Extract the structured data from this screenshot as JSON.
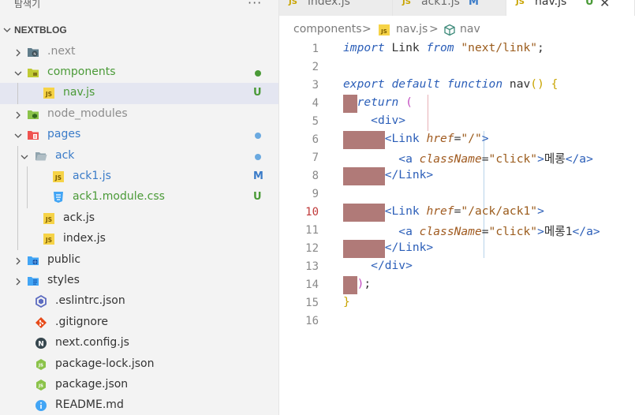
{
  "sidebar": {
    "title": "탐색기",
    "more": "···",
    "project": "NEXTBLOG",
    "items": [
      {
        "name": ".next",
        "style": "dim",
        "icon": "next-folder-icon",
        "twisty": "right",
        "depth": 1,
        "status": "",
        "statusColor": ""
      },
      {
        "name": "components",
        "style": "green",
        "icon": "components-folder-icon",
        "twisty": "down",
        "depth": 1,
        "status": "dot",
        "statusColor": "#4a9a37"
      },
      {
        "name": "nav.js",
        "style": "green",
        "icon": "js-file-icon",
        "twisty": "",
        "depth": 2,
        "status": "U",
        "statusColor": "#4a9a37",
        "selected": true
      },
      {
        "name": "node_modules",
        "style": "dim",
        "icon": "node-modules-folder-icon",
        "twisty": "right",
        "depth": 1,
        "status": "",
        "statusColor": ""
      },
      {
        "name": "pages",
        "style": "blue",
        "icon": "pages-folder-icon",
        "twisty": "down",
        "depth": 1,
        "status": "dot",
        "statusColor": "#6aa9e0"
      },
      {
        "name": "ack",
        "style": "blue",
        "icon": "folder-open-icon",
        "twisty": "down",
        "depth": 2,
        "status": "dot",
        "statusColor": "#6aa9e0"
      },
      {
        "name": "ack1.js",
        "style": "blue",
        "icon": "js-file-icon",
        "twisty": "",
        "depth": 3,
        "status": "M",
        "statusColor": "#3a7bc8"
      },
      {
        "name": "ack1.module.css",
        "style": "green",
        "icon": "css-file-icon",
        "twisty": "",
        "depth": 3,
        "status": "U",
        "statusColor": "#4a9a37"
      },
      {
        "name": "ack.js",
        "style": "",
        "icon": "js-file-icon",
        "twisty": "",
        "depth": 2,
        "status": "",
        "statusColor": ""
      },
      {
        "name": "index.js",
        "style": "",
        "icon": "js-file-icon",
        "twisty": "",
        "depth": 2,
        "status": "",
        "statusColor": ""
      },
      {
        "name": "public",
        "style": "",
        "icon": "public-folder-icon",
        "twisty": "right",
        "depth": 1,
        "status": "",
        "statusColor": ""
      },
      {
        "name": "styles",
        "style": "",
        "icon": "styles-folder-icon",
        "twisty": "right",
        "depth": 1,
        "status": "",
        "statusColor": ""
      },
      {
        "name": ".eslintrc.json",
        "style": "",
        "icon": "eslint-file-icon",
        "twisty": "",
        "depth": 1,
        "status": "",
        "statusColor": ""
      },
      {
        "name": ".gitignore",
        "style": "",
        "icon": "git-file-icon",
        "twisty": "",
        "depth": 1,
        "status": "",
        "statusColor": ""
      },
      {
        "name": "next.config.js",
        "style": "",
        "icon": "next-file-icon",
        "twisty": "",
        "depth": 1,
        "status": "",
        "statusColor": ""
      },
      {
        "name": "package-lock.json",
        "style": "",
        "icon": "node-file-icon",
        "twisty": "",
        "depth": 1,
        "status": "",
        "statusColor": ""
      },
      {
        "name": "package.json",
        "style": "",
        "icon": "node-file-icon",
        "twisty": "",
        "depth": 1,
        "status": "",
        "statusColor": ""
      },
      {
        "name": "README.md",
        "style": "",
        "icon": "info-file-icon",
        "twisty": "",
        "depth": 1,
        "status": "",
        "statusColor": ""
      }
    ]
  },
  "tabs": [
    {
      "label": "index.js",
      "status": "",
      "active": false
    },
    {
      "label": "ack1.js",
      "status": "M",
      "statusColor": "#3a7bc8",
      "active": false
    },
    {
      "label": "nav.js",
      "status": "U",
      "statusColor": "#4a9a37",
      "active": true
    }
  ],
  "tab_icon_text": "JS",
  "breadcrumb": {
    "folder": "components",
    "sep": ">",
    "file": "nav.js",
    "symbol": "nav"
  },
  "editor": {
    "current_line": 10,
    "lines": [
      [
        [
          "kw",
          "import"
        ],
        [
          "id",
          " Link "
        ],
        [
          "kw",
          "from"
        ],
        [
          "id",
          " "
        ],
        [
          "str",
          "\"next/link\""
        ],
        [
          "pn",
          ";"
        ]
      ],
      [],
      [
        [
          "kw",
          "export"
        ],
        [
          "id",
          " "
        ],
        [
          "kw",
          "default"
        ],
        [
          "id",
          " "
        ],
        [
          "kw",
          "function"
        ],
        [
          "id",
          " nav"
        ],
        [
          "br1",
          "()"
        ],
        [
          "id",
          " "
        ],
        [
          "br1",
          "{"
        ]
      ],
      [
        [
          "id",
          "  "
        ],
        [
          "kw",
          "return"
        ],
        [
          "id",
          " "
        ],
        [
          "br2",
          "("
        ]
      ],
      [
        [
          "id",
          "    "
        ],
        [
          "tg",
          "<div>"
        ]
      ],
      [
        [
          "id",
          "      "
        ],
        [
          "tg",
          "<Link"
        ],
        [
          "id",
          " "
        ],
        [
          "at",
          "href"
        ],
        [
          "pn",
          "="
        ],
        [
          "str",
          "\"/\""
        ],
        [
          "tg",
          ">"
        ]
      ],
      [
        [
          "id",
          "        "
        ],
        [
          "tg",
          "<a"
        ],
        [
          "id",
          " "
        ],
        [
          "at",
          "className"
        ],
        [
          "pn",
          "="
        ],
        [
          "str",
          "\"click\""
        ],
        [
          "tg",
          ">"
        ],
        [
          "ko",
          "메롱"
        ],
        [
          "tg",
          "</a>"
        ]
      ],
      [
        [
          "id",
          "      "
        ],
        [
          "tg",
          "</Link>"
        ]
      ],
      [],
      [
        [
          "id",
          "      "
        ],
        [
          "tg",
          "<Link"
        ],
        [
          "id",
          " "
        ],
        [
          "at",
          "href"
        ],
        [
          "pn",
          "="
        ],
        [
          "str",
          "\"/ack/ack1\""
        ],
        [
          "tg",
          ">"
        ]
      ],
      [
        [
          "id",
          "        "
        ],
        [
          "tg",
          "<a"
        ],
        [
          "id",
          " "
        ],
        [
          "at",
          "className"
        ],
        [
          "pn",
          "="
        ],
        [
          "str",
          "\"click\""
        ],
        [
          "tg",
          ">"
        ],
        [
          "ko",
          "메롱1"
        ],
        [
          "tg",
          "</a>"
        ]
      ],
      [
        [
          "id",
          "      "
        ],
        [
          "tg",
          "</Link>"
        ]
      ],
      [
        [
          "id",
          "    "
        ],
        [
          "tg",
          "</div>"
        ]
      ],
      [
        [
          "id",
          "  "
        ],
        [
          "br2",
          ")"
        ],
        [
          "pn",
          ";"
        ]
      ],
      [
        [
          "br1",
          "}"
        ]
      ],
      []
    ]
  },
  "colors": {
    "error_highlight": "#b07a78",
    "added": "#4a9a37",
    "modified": "#3a7bc8"
  }
}
